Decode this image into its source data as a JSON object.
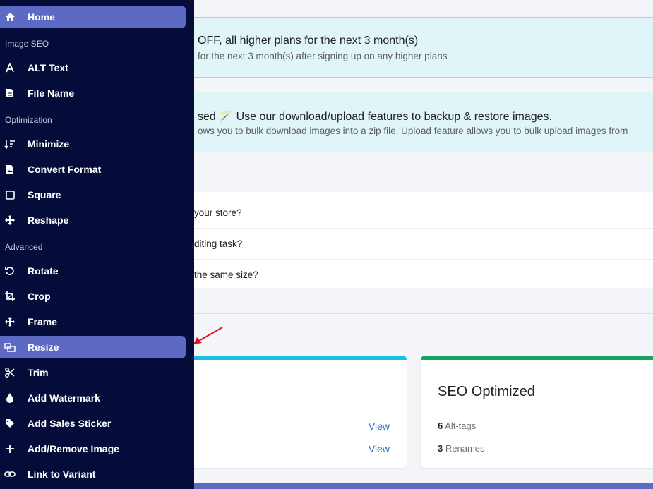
{
  "banners": [
    {
      "title": "OFF, all higher plans for the next 3 month(s)",
      "sub": "for the next 3 month(s) after signing up on any higher plans"
    },
    {
      "title": "sed 🪄 Use our download/upload features to backup & restore images.",
      "sub": "ows you to bulk download images into a zip file. Upload feature allows you to bulk upload images from"
    }
  ],
  "faq": [
    "your store?",
    "diting task?",
    "the same size?"
  ],
  "cards": {
    "left": {
      "views": [
        "View",
        "View"
      ],
      "accent": "#1bbfe0"
    },
    "seo": {
      "title": "SEO Optimized",
      "stats": [
        {
          "count": "6",
          "label": "Alt-tags"
        },
        {
          "count": "3",
          "label": "Renames"
        }
      ],
      "accent": "#1aa260"
    }
  },
  "sidebar": {
    "bg": "#050c3a",
    "active_color": "#5c6ac4",
    "home": {
      "label": "Home",
      "icon": "home-icon"
    },
    "sections": {
      "image_seo": "Image SEO",
      "optimization": "Optimization",
      "advanced": "Advanced"
    },
    "items": [
      {
        "label": "ALT Text",
        "icon": "alt-text-icon"
      },
      {
        "label": "File Name",
        "icon": "file-icon"
      },
      {
        "label": "Minimize",
        "icon": "sort-down-icon"
      },
      {
        "label": "Convert Format",
        "icon": "image-file-icon"
      },
      {
        "label": "Square",
        "icon": "square-icon"
      },
      {
        "label": "Reshape",
        "icon": "move-icon"
      },
      {
        "label": "Rotate",
        "icon": "rotate-icon"
      },
      {
        "label": "Crop",
        "icon": "crop-icon"
      },
      {
        "label": "Frame",
        "icon": "move-icon"
      },
      {
        "label": "Resize",
        "icon": "resize-icon"
      },
      {
        "label": "Trim",
        "icon": "scissors-icon"
      },
      {
        "label": "Add Watermark",
        "icon": "drop-icon"
      },
      {
        "label": "Add Sales Sticker",
        "icon": "tag-icon"
      },
      {
        "label": "Add/Remove Image",
        "icon": "plus-icon"
      },
      {
        "label": "Link to Variant",
        "icon": "link-icon"
      }
    ]
  }
}
